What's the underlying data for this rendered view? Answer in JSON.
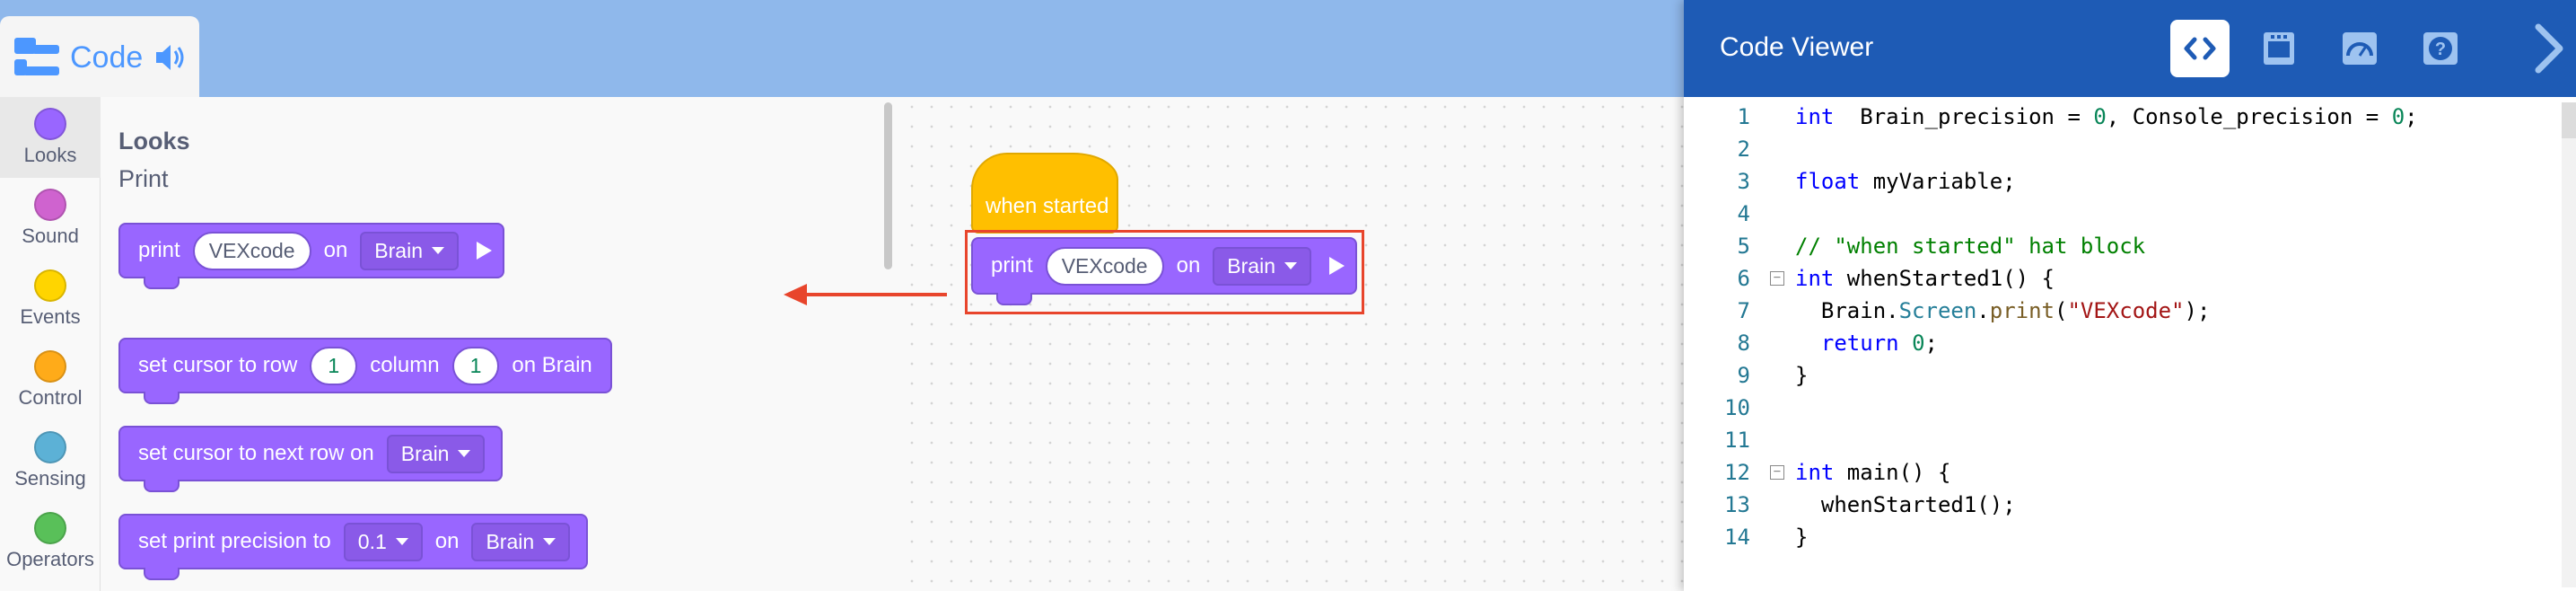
{
  "toolbar": {
    "code_tab_label": "Code"
  },
  "categories": [
    {
      "name": "Looks",
      "color": "#9966ff"
    },
    {
      "name": "Sound",
      "color": "#cf63cf"
    },
    {
      "name": "Events",
      "color": "#ffd500"
    },
    {
      "name": "Control",
      "color": "#ffab19"
    },
    {
      "name": "Sensing",
      "color": "#5cb1d6"
    },
    {
      "name": "Operators",
      "color": "#59c059"
    }
  ],
  "flyout": {
    "heading": "Looks",
    "subheading": "Print",
    "blocks": {
      "print": {
        "label": "print",
        "value": "VEXcode",
        "on": "on",
        "device": "Brain"
      },
      "set_cursor": {
        "label": "set cursor to row",
        "row": "1",
        "column_label": "column",
        "column": "1",
        "suffix": "on Brain"
      },
      "next_row": {
        "label": "set cursor to next row on",
        "device": "Brain"
      },
      "precision": {
        "label": "set print precision to",
        "value": "0.1",
        "on": "on",
        "device": "Brain"
      }
    }
  },
  "workspace": {
    "hat_label": "when started",
    "print_block": {
      "label": "print",
      "value": "VEXcode",
      "on": "on",
      "device": "Brain"
    }
  },
  "code_viewer": {
    "title": "Code Viewer",
    "lines": [
      {
        "n": "1",
        "parts": [
          [
            "kw",
            "int"
          ],
          [
            "",
            "  Brain_precision = "
          ],
          [
            "num",
            "0"
          ],
          [
            "",
            ", Console_precision = "
          ],
          [
            "num",
            "0"
          ],
          [
            "",
            ";"
          ]
        ]
      },
      {
        "n": "2",
        "parts": []
      },
      {
        "n": "3",
        "parts": [
          [
            "kw",
            "float"
          ],
          [
            "",
            " myVariable;"
          ]
        ]
      },
      {
        "n": "4",
        "parts": []
      },
      {
        "n": "5",
        "parts": [
          [
            "cmt",
            "// \"when started\" hat block"
          ]
        ]
      },
      {
        "n": "6",
        "fold": true,
        "parts": [
          [
            "kw",
            "int"
          ],
          [
            "",
            " whenStarted1() {"
          ]
        ]
      },
      {
        "n": "7",
        "parts": [
          [
            "",
            "  Brain."
          ],
          [
            "mem",
            "Screen"
          ],
          [
            "",
            "."
          ],
          [
            "fn",
            "print"
          ],
          [
            "",
            "("
          ],
          [
            "str",
            "\"VEXcode\""
          ],
          [
            "",
            ");"
          ]
        ]
      },
      {
        "n": "8",
        "parts": [
          [
            "",
            "  "
          ],
          [
            "kw",
            "return"
          ],
          [
            "",
            " "
          ],
          [
            "num",
            "0"
          ],
          [
            "",
            ";"
          ]
        ]
      },
      {
        "n": "9",
        "parts": [
          [
            "",
            "}"
          ]
        ]
      },
      {
        "n": "10",
        "parts": []
      },
      {
        "n": "11",
        "parts": []
      },
      {
        "n": "12",
        "fold": true,
        "parts": [
          [
            "kw",
            "int"
          ],
          [
            "",
            " main() {"
          ]
        ]
      },
      {
        "n": "13",
        "parts": [
          [
            "",
            "  whenStarted1();"
          ]
        ]
      },
      {
        "n": "14",
        "parts": [
          [
            "",
            "}"
          ]
        ]
      }
    ]
  }
}
